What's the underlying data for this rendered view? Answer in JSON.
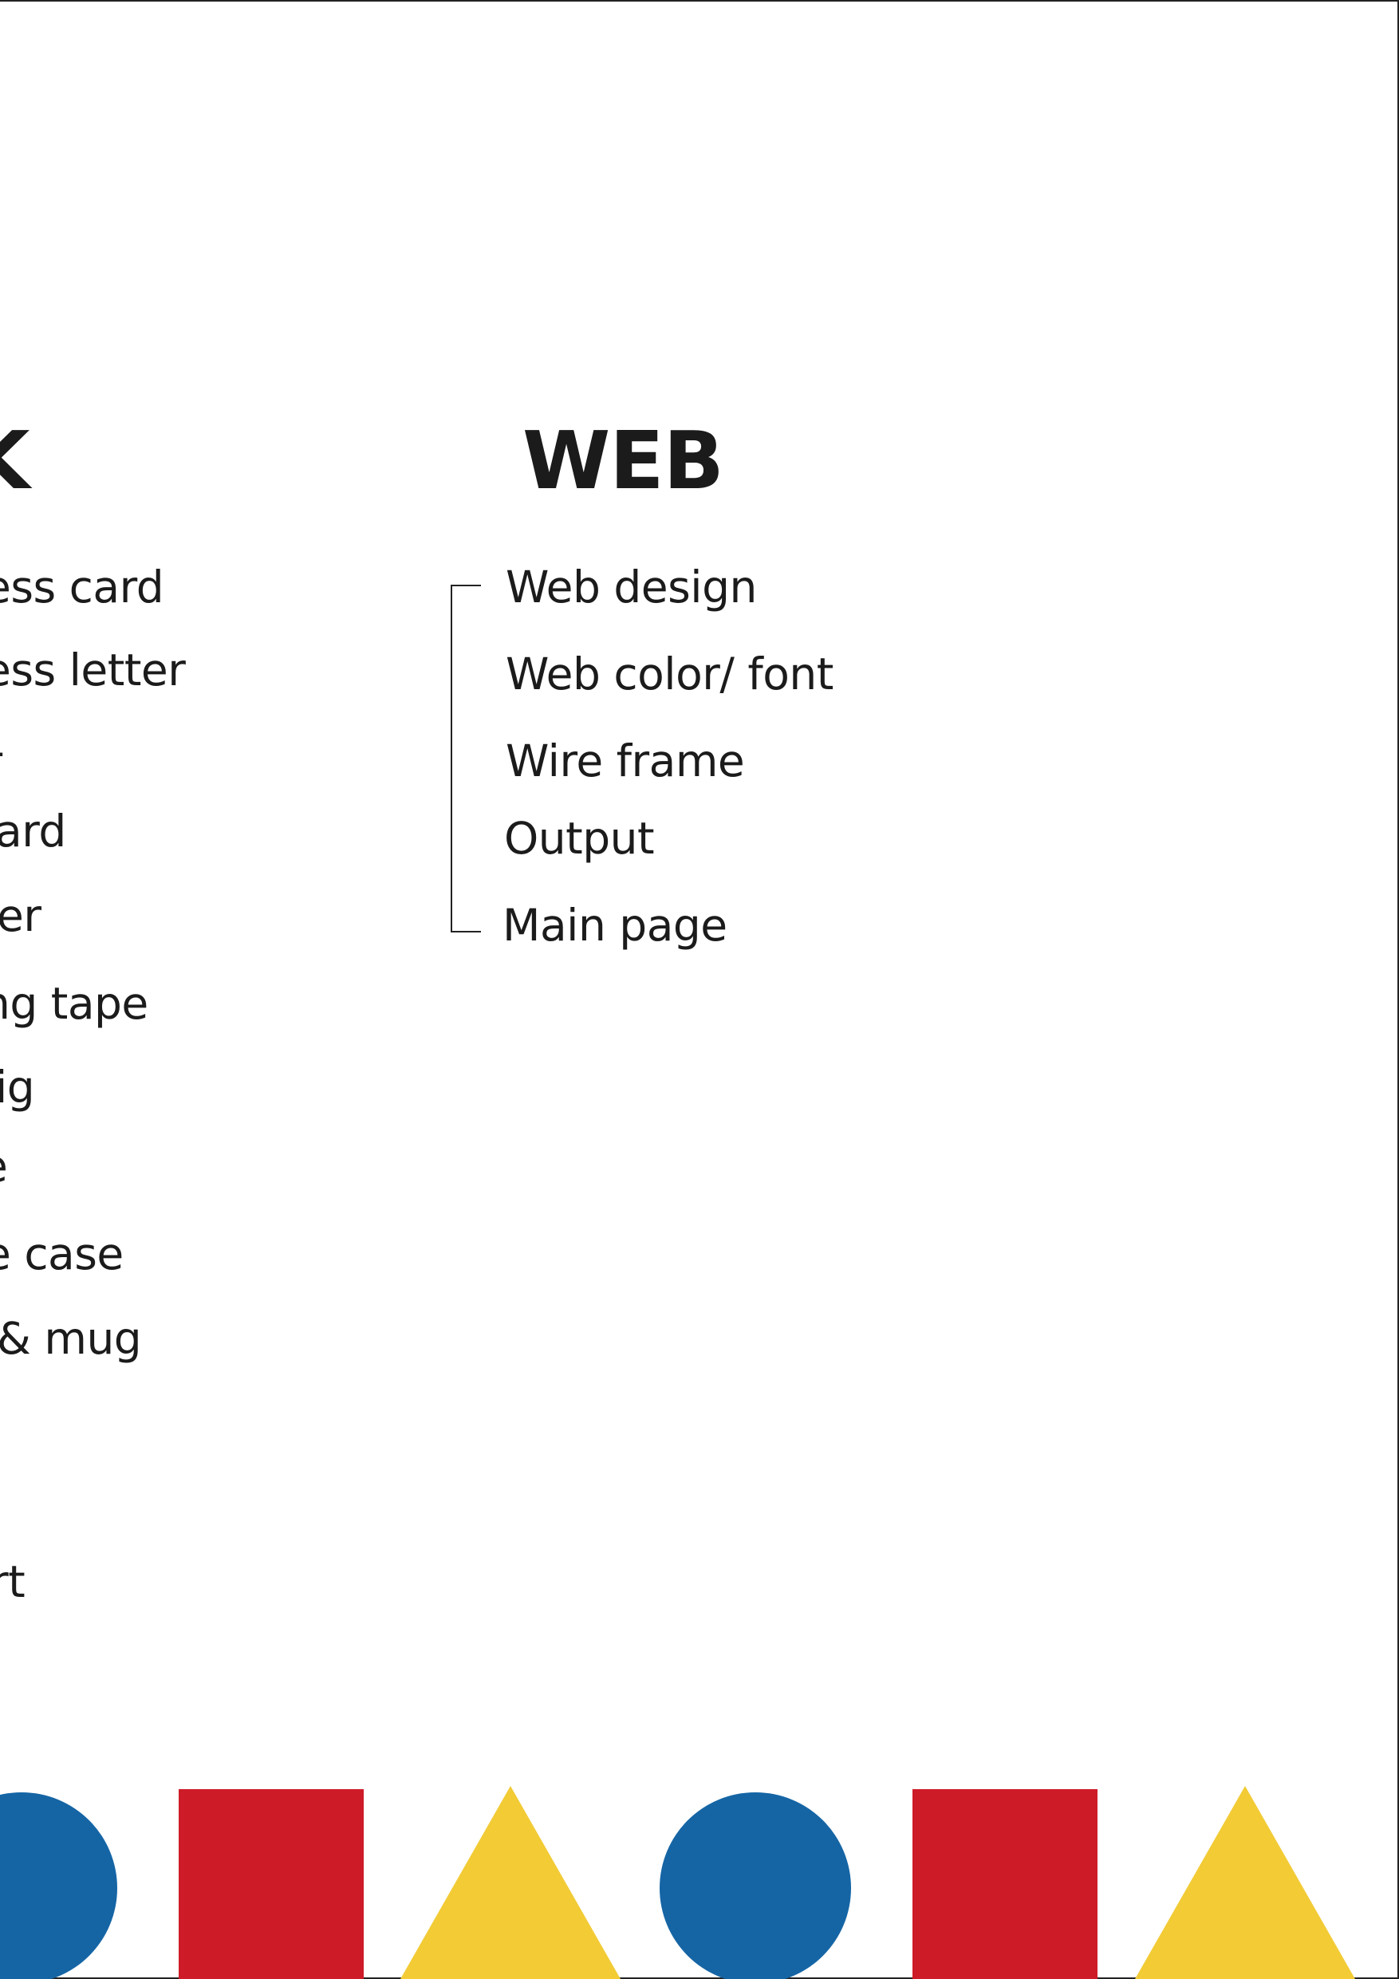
{
  "left_column": {
    "heading_fragment": "K",
    "items": [
      "ess card",
      "ess letter",
      "-",
      "ard",
      "er",
      "ng tape",
      "ig",
      "e",
      "e case",
      "& mug",
      "rt"
    ]
  },
  "web_column": {
    "heading": "WEB",
    "items": [
      "Web design",
      "Web color/ font",
      "Wire frame",
      "Output",
      "Main page"
    ]
  },
  "shapes": [
    {
      "kind": "circle",
      "color": "#1565a5"
    },
    {
      "kind": "square",
      "color": "#ce1b28"
    },
    {
      "kind": "triangle",
      "color": "#f2cb35"
    },
    {
      "kind": "circle",
      "color": "#1565a5"
    },
    {
      "kind": "square",
      "color": "#ce1b28"
    },
    {
      "kind": "triangle",
      "color": "#f2cb35"
    }
  ]
}
